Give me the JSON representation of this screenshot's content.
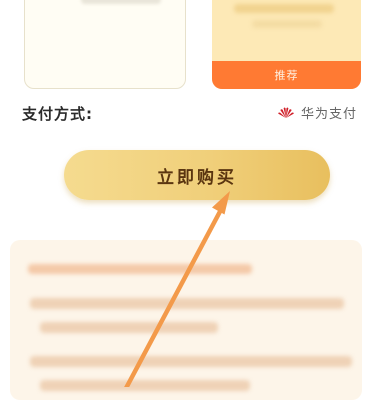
{
  "plans": {
    "recommended_badge": "推荐"
  },
  "payment": {
    "label": "支付方式:",
    "method": "华为支付",
    "method_icon": "huawei-logo-icon"
  },
  "buy_button": {
    "label": "立即购买"
  },
  "colors": {
    "accent_orange": "#ff7a33",
    "button_gold": "#f0cf7a",
    "button_text": "#5a3510",
    "huawei_red": "#d0202a",
    "arrow": "#f39a4a"
  }
}
